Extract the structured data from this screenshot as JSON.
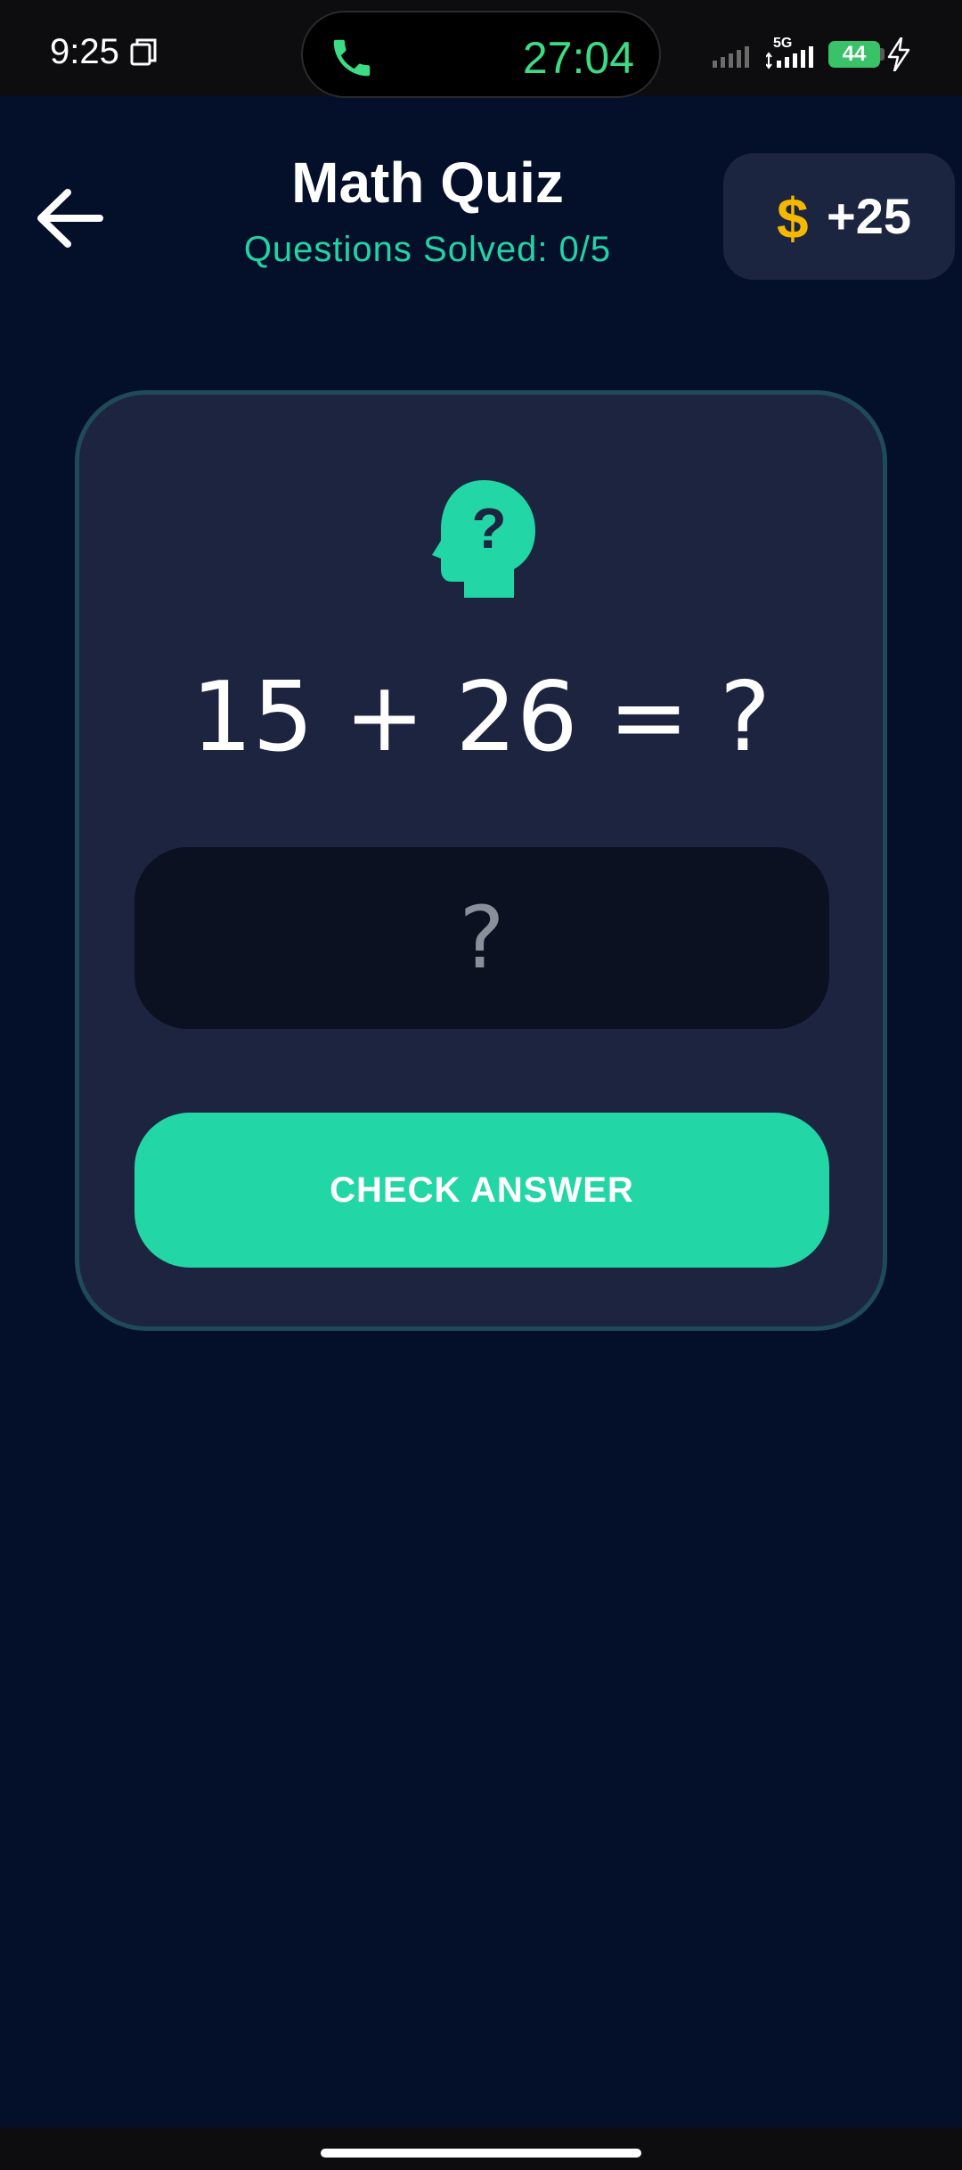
{
  "status_bar": {
    "time": "9:25",
    "call_timer": "27:04",
    "network_label": "5G",
    "battery_level": "44"
  },
  "header": {
    "title": "Math Quiz",
    "progress_label": "Questions Solved: 0/5",
    "coin_symbol": "$",
    "coin_count": "+25"
  },
  "quiz": {
    "question": "15 + 26 = ?",
    "answer_value": "",
    "answer_placeholder": "?",
    "check_label": "CHECK ANSWER"
  },
  "colors": {
    "background": "#041029",
    "card": "#1c2440",
    "accent": "#22d6a6",
    "coin": "#f5b800"
  },
  "icons": [
    "copy-icon",
    "phone-icon",
    "signal-icon",
    "battery-icon",
    "bolt-icon",
    "back-arrow-icon",
    "head-question-icon",
    "dollar-icon"
  ]
}
